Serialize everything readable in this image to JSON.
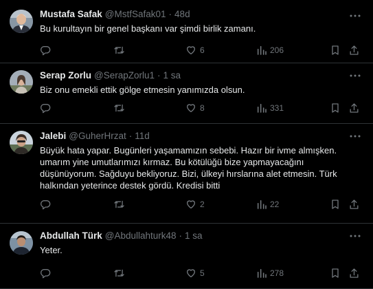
{
  "tweets": [
    {
      "name": "Mustafa Safak",
      "handle": "@MstfSafak01",
      "separator": "·",
      "time": "48d",
      "text": "Bu kurultayın bir genel başkanı  var şimdi birlik zamanı.",
      "likes": "6",
      "views": "206"
    },
    {
      "name": "Serap Zorlu",
      "handle": "@SerapZorlu1",
      "separator": "·",
      "time": "1 sa",
      "text": "Biz onu emekli ettik gölge etmesin yanımızda olsun.",
      "likes": "8",
      "views": "331"
    },
    {
      "name": "Jalebi",
      "handle": "@GuherHrzat",
      "separator": "·",
      "time": "11d",
      "text": "Büyük hata yapar. Bugünleri yaşamamızın sebebi. Hazır bir ivme almışken. umarım yine umutlarımızı kırmaz. Bu kötülüğü bize yapmayacağını düşünüyorum. Sağduyu bekliyoruz. Bizi, ülkeyi hırslarına alet etmesin. Türk halkından yeterince destek gördü. Kredisi bitti",
      "likes": "2",
      "views": "22"
    },
    {
      "name": "Abdullah Türk",
      "handle": "@Abdullahturk48",
      "separator": "·",
      "time": "1 sa",
      "text": "Yeter.",
      "likes": "5",
      "views": "278"
    }
  ],
  "icons": {
    "reply": "reply-icon",
    "retweet": "retweet-icon",
    "like": "heart-icon",
    "views": "views-icon",
    "bookmark": "bookmark-icon",
    "share": "share-icon",
    "more": "more-icon"
  },
  "colors": {
    "background": "#000000",
    "text": "#e7e9ea",
    "muted": "#71767b",
    "divider": "#2f3336"
  }
}
